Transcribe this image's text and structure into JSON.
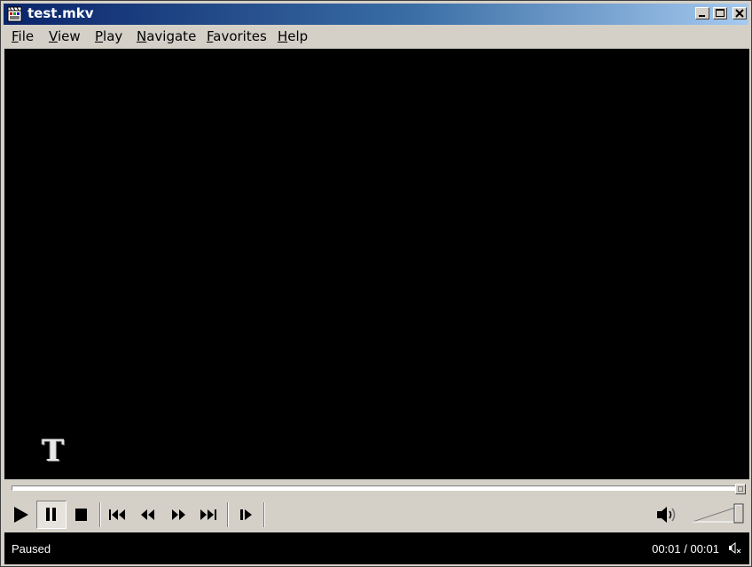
{
  "window": {
    "title": "test.mkv"
  },
  "menu": [
    {
      "accel": "F",
      "rest": "ile"
    },
    {
      "accel": "V",
      "rest": "iew"
    },
    {
      "accel": "P",
      "rest": "lay"
    },
    {
      "accel": "N",
      "rest": "avigate"
    },
    {
      "accel": "F",
      "rest": "avorites"
    },
    {
      "accel": "H",
      "rest": "elp"
    }
  ],
  "video": {
    "watermark": "T"
  },
  "seek": {
    "progress": 1.0
  },
  "controls": {
    "icons": [
      "play-icon",
      "pause-icon",
      "stop-icon",
      "skip-previous-icon",
      "rewind-icon",
      "fast-forward-icon",
      "skip-next-icon",
      "frame-step-icon",
      "speaker-icon"
    ],
    "pressed": "pause-icon",
    "volume_level": 1.0
  },
  "status": {
    "state": "Paused",
    "time": "00:01 / 00:01"
  },
  "colors": {
    "titlebar_start": "#0a246a",
    "titlebar_end": "#a6caf0",
    "chrome": "#d4d0c8",
    "video_bg": "#000000"
  }
}
